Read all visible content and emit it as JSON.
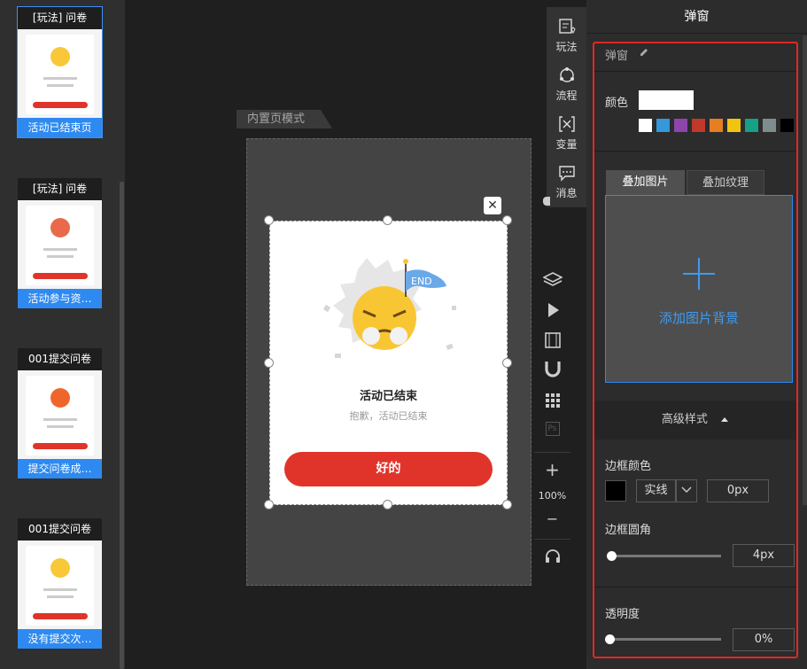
{
  "left_pages": [
    {
      "header": "[玩法] 问卷",
      "caption": "活动已结束页",
      "active": true
    },
    {
      "header": "[玩法] 问卷",
      "caption": "活动参与资…",
      "active": false
    },
    {
      "header": "001提交问卷",
      "caption": "提交问卷成…",
      "active": false
    },
    {
      "header": "001提交问卷",
      "caption": "没有提交次…",
      "active": false
    }
  ],
  "canvas": {
    "mode_tab": "内置页模式",
    "popup": {
      "flag_text": "END",
      "title": "活动已结束",
      "subtitle": "抱歉，活动已结束",
      "button": "好的",
      "close_glyph": "✕"
    }
  },
  "function_menu": [
    {
      "label": "玩法",
      "icon": "gameplay-icon"
    },
    {
      "label": "流程",
      "icon": "flow-icon"
    },
    {
      "label": "变量",
      "icon": "variable-icon"
    },
    {
      "label": "消息",
      "icon": "message-icon"
    }
  ],
  "tools": {
    "zoom": "100%",
    "icons": [
      "layers-icon",
      "play-icon",
      "film-icon",
      "magnet-icon",
      "grid-icon",
      "ps-icon",
      "zoom-in-icon",
      "zoom-out-icon",
      "headset-icon"
    ],
    "plus": "+",
    "minus": "−",
    "ps": "Ps"
  },
  "panel": {
    "title": "弹窗",
    "section_name": "弹窗",
    "color_label": "颜色",
    "color_value": "#ffffff",
    "swatches": [
      "#ffffff",
      "#3498db",
      "#8e44ad",
      "#c0392b",
      "#e67e22",
      "#f1c40f",
      "#16a085",
      "#7f8c8d",
      "#000000"
    ],
    "tab_overlay_image": "叠加图片",
    "tab_overlay_texture": "叠加纹理",
    "add_image_bg": "添加图片背景",
    "advanced_style": "高级样式",
    "border_color_label": "边框颜色",
    "border_style": "实线",
    "border_width": "0px",
    "border_radius_label": "边框圆角",
    "border_radius_value": "4px",
    "opacity_label": "透明度",
    "opacity_value": "0%"
  },
  "colors": {
    "accent_blue": "#2e8af0",
    "highlight_red": "#e02727",
    "button_red": "#e0342b"
  }
}
